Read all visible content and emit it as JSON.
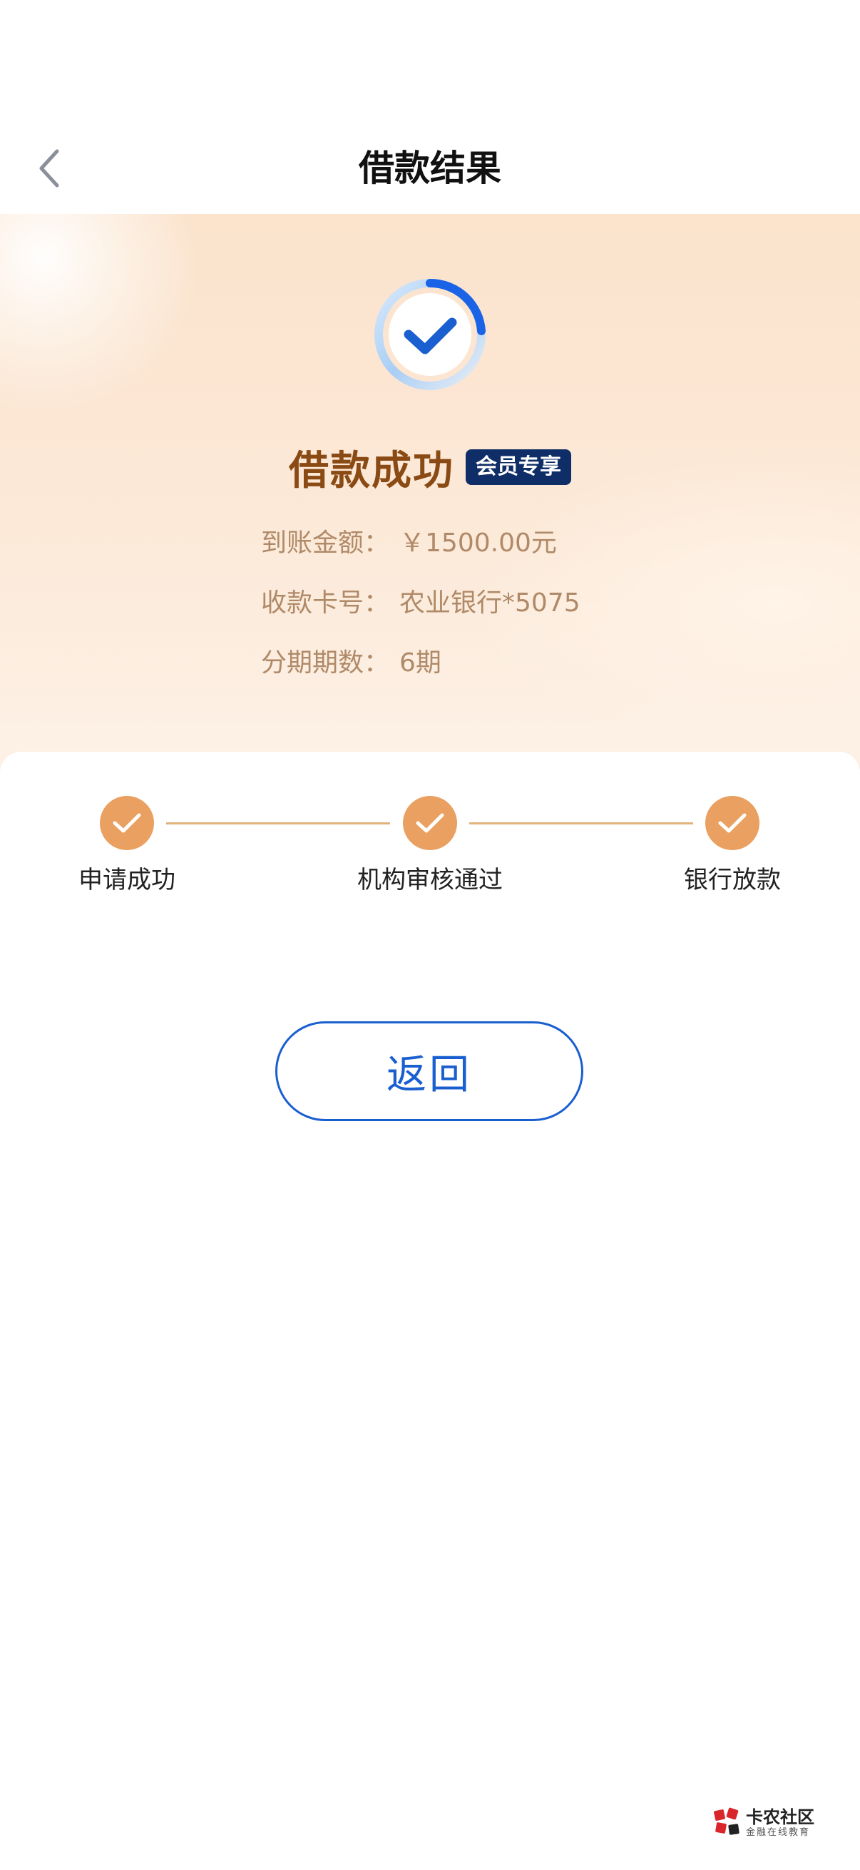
{
  "nav": {
    "title": "借款结果",
    "back_icon": "chevron-left-icon"
  },
  "result": {
    "icon": "success-check-icon",
    "title": "借款成功",
    "badge": "会员专享",
    "info": [
      {
        "label": "到账金额",
        "sep": "：",
        "value": "￥1500.00元"
      },
      {
        "label": "收款卡号",
        "sep": "：",
        "value": "农业银行*5075"
      },
      {
        "label": "分期期数",
        "sep": "：",
        "value": "6期"
      }
    ]
  },
  "steps": [
    {
      "label": "申请成功",
      "icon": "check-icon"
    },
    {
      "label": "机构审核通过",
      "icon": "check-icon"
    },
    {
      "label": "银行放款",
      "icon": "check-icon"
    }
  ],
  "actions": {
    "return_label": "返回"
  },
  "watermark": {
    "name": "卡农社区",
    "subtitle": "金融在线教育",
    "logo_icon": "kanong-logo-icon"
  },
  "colors": {
    "accent_blue": "#1a5fd0",
    "step_orange": "#e9a060",
    "title_brown": "#8a4a14",
    "badge_navy": "#0f2d66"
  }
}
